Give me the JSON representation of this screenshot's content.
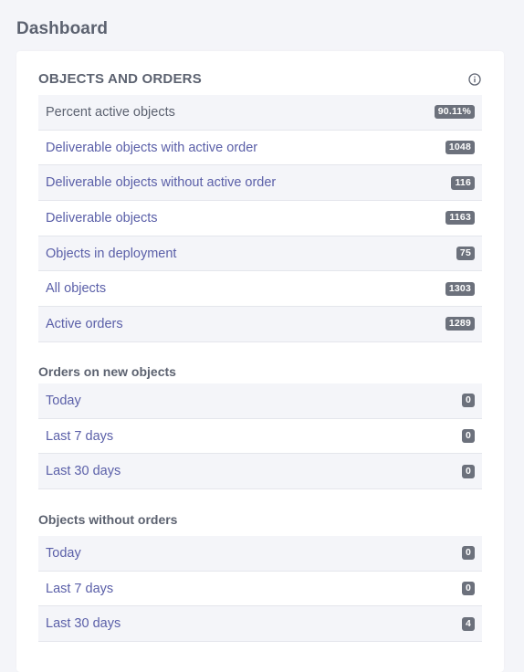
{
  "page": {
    "title": "Dashboard"
  },
  "objects_and_orders": {
    "title": "OBJECTS AND ORDERS",
    "rows": [
      {
        "label": "Percent active objects",
        "value": "90.11%"
      },
      {
        "label": "Deliverable objects with active order",
        "value": "1048"
      },
      {
        "label": "Deliverable objects without active order",
        "value": "116"
      },
      {
        "label": "Deliverable objects",
        "value": "1163"
      },
      {
        "label": "Objects in deployment",
        "value": "75"
      },
      {
        "label": "All objects",
        "value": "1303"
      },
      {
        "label": "Active orders",
        "value": "1289"
      }
    ]
  },
  "orders_on_new_objects": {
    "title": "Orders on new objects",
    "rows": [
      {
        "label": "Today",
        "value": "0"
      },
      {
        "label": "Last 7 days",
        "value": "0"
      },
      {
        "label": "Last 30 days",
        "value": "0"
      }
    ]
  },
  "objects_without_orders": {
    "title": "Objects without orders",
    "rows": [
      {
        "label": "Today",
        "value": "0"
      },
      {
        "label": "Last 7 days",
        "value": "0"
      },
      {
        "label": "Last 30 days",
        "value": "4"
      }
    ]
  },
  "colors": {
    "link": "#5a5fa8",
    "badge": "#6c717c",
    "stripe": "#f4f5f9",
    "background": "#f4f5f9"
  },
  "icons": {
    "info": "info-icon"
  }
}
